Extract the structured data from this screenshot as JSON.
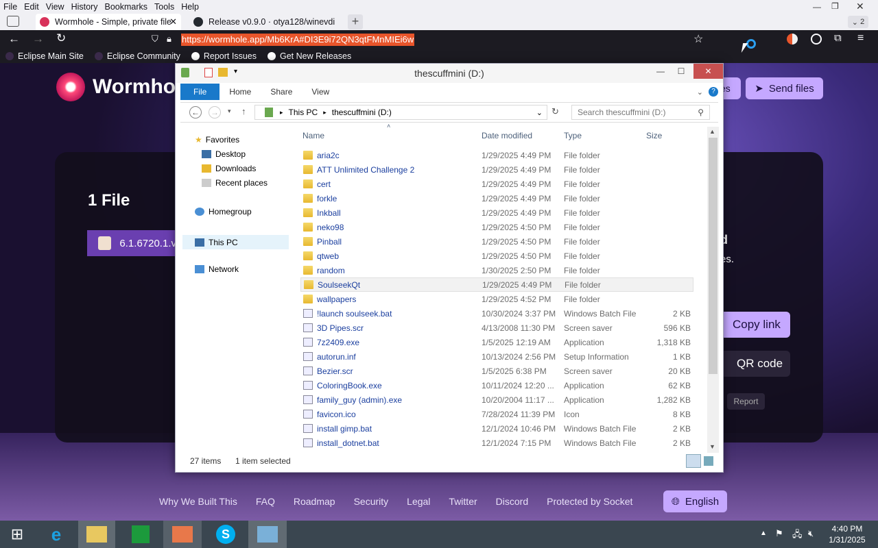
{
  "menubar": {
    "items": [
      "File",
      "Edit",
      "View",
      "History",
      "Bookmarks",
      "Tools",
      "Help"
    ]
  },
  "tabs": [
    {
      "label": "Wormhole - Simple, private file"
    },
    {
      "label": "Release v0.9.0 · otya128/winevdi"
    }
  ],
  "tab_overflow_count": "2",
  "url": "https://wormhole.app/Mb6KrA#DI3E9i72QN3qtFMnMIEi6w",
  "bookmarks": [
    "Eclipse Main Site",
    "Eclipse Community",
    "Report Issues",
    "Get New Releases"
  ],
  "wormhole": {
    "logo": "Wormhole",
    "send_files": "Send files",
    "tab_other": "es",
    "file_count": "1 File",
    "file_name": "6.1.6720.1.v",
    "side_d": "d",
    "side_es": "es.",
    "copy_link": "Copy link",
    "qr_code": "QR code",
    "report": "Report",
    "footer": [
      "Why We Built This",
      "FAQ",
      "Roadmap",
      "Security",
      "Legal",
      "Twitter",
      "Discord",
      "Protected by Socket"
    ],
    "language": "English"
  },
  "explorer": {
    "title": "thescuffmini (D:)",
    "ribbon": {
      "file": "File",
      "home": "Home",
      "share": "Share",
      "view": "View"
    },
    "address": {
      "this_pc": "This PC",
      "drive": "thescuffmini (D:)"
    },
    "search_placeholder": "Search thescuffmini (D:)",
    "nav": {
      "favorites": "Favorites",
      "desktop": "Desktop",
      "downloads": "Downloads",
      "recent": "Recent places",
      "homegroup": "Homegroup",
      "this_pc": "This PC",
      "network": "Network"
    },
    "columns": {
      "name": "Name",
      "date": "Date modified",
      "type": "Type",
      "size": "Size"
    },
    "files": [
      {
        "name": "aria2c",
        "date": "1/29/2025 4:49 PM",
        "type": "File folder",
        "size": "",
        "kind": "folder"
      },
      {
        "name": "ATT Unlimited Challenge 2",
        "date": "1/29/2025 4:49 PM",
        "type": "File folder",
        "size": "",
        "kind": "folder"
      },
      {
        "name": "cert",
        "date": "1/29/2025 4:49 PM",
        "type": "File folder",
        "size": "",
        "kind": "folder"
      },
      {
        "name": "forkle",
        "date": "1/29/2025 4:49 PM",
        "type": "File folder",
        "size": "",
        "kind": "folder"
      },
      {
        "name": "Inkball",
        "date": "1/29/2025 4:49 PM",
        "type": "File folder",
        "size": "",
        "kind": "folder"
      },
      {
        "name": "neko98",
        "date": "1/29/2025 4:50 PM",
        "type": "File folder",
        "size": "",
        "kind": "folder"
      },
      {
        "name": "Pinball",
        "date": "1/29/2025 4:50 PM",
        "type": "File folder",
        "size": "",
        "kind": "folder"
      },
      {
        "name": "qtweb",
        "date": "1/29/2025 4:50 PM",
        "type": "File folder",
        "size": "",
        "kind": "folder"
      },
      {
        "name": "random",
        "date": "1/30/2025 2:50 PM",
        "type": "File folder",
        "size": "",
        "kind": "folder"
      },
      {
        "name": "SoulseekQt",
        "date": "1/29/2025 4:49 PM",
        "type": "File folder",
        "size": "",
        "kind": "folder"
      },
      {
        "name": "wallpapers",
        "date": "1/29/2025 4:52 PM",
        "type": "File folder",
        "size": "",
        "kind": "folder"
      },
      {
        "name": "!launch soulseek.bat",
        "date": "10/30/2024 3:37 PM",
        "type": "Windows Batch File",
        "size": "2 KB",
        "kind": "file"
      },
      {
        "name": "3D Pipes.scr",
        "date": "4/13/2008 11:30 PM",
        "type": "Screen saver",
        "size": "596 KB",
        "kind": "file"
      },
      {
        "name": "7z2409.exe",
        "date": "1/5/2025 12:19 AM",
        "type": "Application",
        "size": "1,318 KB",
        "kind": "file"
      },
      {
        "name": "autorun.inf",
        "date": "10/13/2024 2:56 PM",
        "type": "Setup Information",
        "size": "1 KB",
        "kind": "file"
      },
      {
        "name": "Bezier.scr",
        "date": "1/5/2025 6:38 PM",
        "type": "Screen saver",
        "size": "20 KB",
        "kind": "file"
      },
      {
        "name": "ColoringBook.exe",
        "date": "10/11/2024 12:20 ...",
        "type": "Application",
        "size": "62 KB",
        "kind": "file"
      },
      {
        "name": "family_guy (admin).exe",
        "date": "10/20/2004 11:17 ...",
        "type": "Application",
        "size": "1,282 KB",
        "kind": "file"
      },
      {
        "name": "favicon.ico",
        "date": "7/28/2024 11:39 PM",
        "type": "Icon",
        "size": "8 KB",
        "kind": "file"
      },
      {
        "name": "install gimp.bat",
        "date": "12/1/2024 10:46 PM",
        "type": "Windows Batch File",
        "size": "2 KB",
        "kind": "file"
      },
      {
        "name": "install_dotnet.bat",
        "date": "12/1/2024 7:15 PM",
        "type": "Windows Batch File",
        "size": "2 KB",
        "kind": "file"
      }
    ],
    "selected_row": 9,
    "status": {
      "count": "27 items",
      "selected": "1 item selected"
    }
  },
  "taskbar": {
    "time": "4:40 PM",
    "date": "1/31/2025"
  }
}
